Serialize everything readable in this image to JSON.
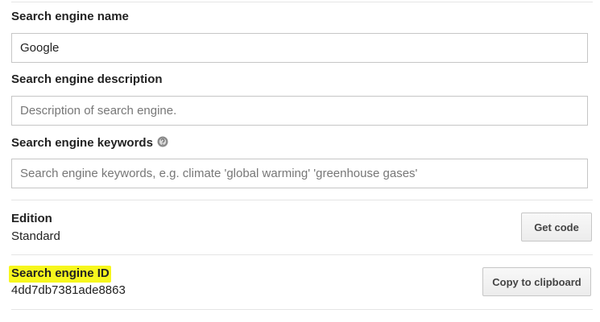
{
  "fields": {
    "name": {
      "label": "Search engine name",
      "value": "Google"
    },
    "description": {
      "label": "Search engine description",
      "placeholder": "Description of search engine."
    },
    "keywords": {
      "label": "Search engine keywords",
      "placeholder": "Search engine keywords, e.g. climate 'global warming' 'greenhouse gases'",
      "help_icon": "help-icon"
    }
  },
  "edition": {
    "label": "Edition",
    "value": "Standard",
    "button_label": "Get code"
  },
  "engine_id": {
    "label": "Search engine ID",
    "value": "4dd7db7381ade8863",
    "button_label": "Copy to clipboard",
    "highlight_color": "#f7f71d"
  }
}
